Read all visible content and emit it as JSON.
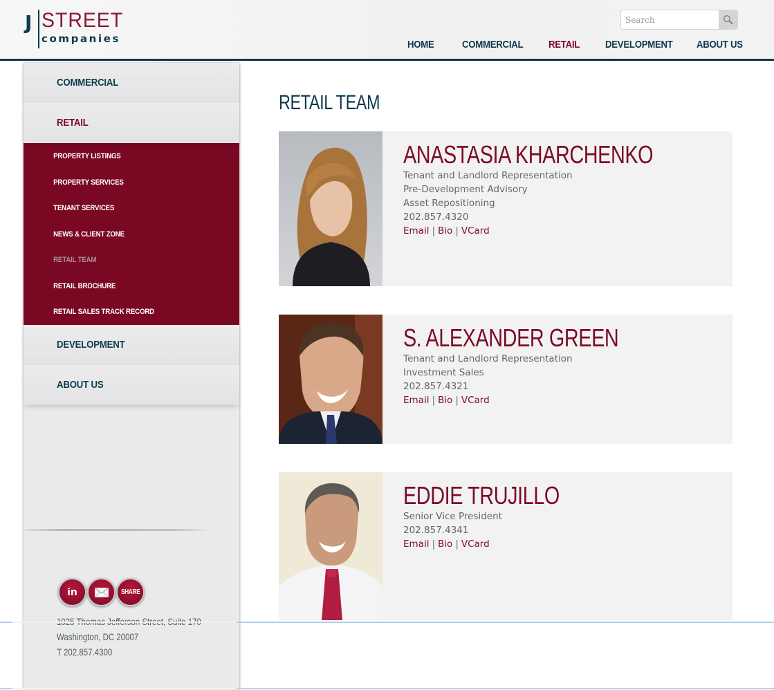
{
  "header": {
    "logo": {
      "j": "J",
      "street": "STREET",
      "companies": "companies"
    },
    "search": {
      "placeholder": "Search",
      "value": "",
      "icon": "search-icon"
    },
    "nav": [
      {
        "label": "HOME",
        "active": false
      },
      {
        "label": "COMMERCIAL",
        "active": false
      },
      {
        "label": "RETAIL",
        "active": true
      },
      {
        "label": "DEVELOPMENT",
        "active": false
      },
      {
        "label": "ABOUT US",
        "active": false
      }
    ]
  },
  "sidebar": {
    "items": [
      {
        "label": "COMMERCIAL",
        "active": false
      },
      {
        "label": "RETAIL",
        "active": true
      },
      {
        "label": "DEVELOPMENT",
        "active": false
      },
      {
        "label": "ABOUT US",
        "active": false
      }
    ],
    "retail_submenu": [
      {
        "label": "PROPERTY LISTINGS",
        "current": false
      },
      {
        "label": "PROPERTY SERVICES",
        "current": false
      },
      {
        "label": "TENANT SERVICES",
        "current": false
      },
      {
        "label": "NEWS & CLIENT ZONE",
        "current": false
      },
      {
        "label": "RETAIL TEAM",
        "current": true
      },
      {
        "label": "RETAIL BROCHURE",
        "current": false
      },
      {
        "label": "RETAIL SALES TRACK RECORD",
        "current": false
      }
    ],
    "social": [
      {
        "icon": "linkedin-icon",
        "label": "in"
      },
      {
        "icon": "email-icon",
        "label": ""
      },
      {
        "icon": "share-icon",
        "label": "SHARE"
      }
    ],
    "address": {
      "line1": "1025 Thomas Jefferson Street, Suite 170",
      "line2": "Washington, DC 20007",
      "phone": "T 202.857.4300"
    }
  },
  "main": {
    "title": "RETAIL TEAM",
    "team": [
      {
        "name": "ANASTASIA KHARCHENKO",
        "details": [
          "Tenant and Landlord Representation",
          "Pre-Development Advisory",
          "Asset Repositioning"
        ],
        "phone": "202.857.4320",
        "links": [
          "Email",
          "Bio",
          "VCard"
        ],
        "link_separator": "|"
      },
      {
        "name": "S. ALEXANDER GREEN",
        "details": [
          "Tenant and Landlord Representation",
          "Investment Sales"
        ],
        "phone": "202.857.4321",
        "links": [
          "Email",
          "Bio",
          "VCard"
        ],
        "link_separator": "|"
      },
      {
        "name": "EDDIE TRUJILLO",
        "details": [
          "Senior Vice President"
        ],
        "phone": "202.857.4341",
        "links": [
          "Email",
          "Bio",
          "VCard"
        ],
        "link_separator": "|"
      }
    ]
  },
  "colors": {
    "navy": "#0d3a4d",
    "maroon": "#7c0a26",
    "submenu_bg": "#7b0823",
    "card_bg": "#f2f2f2",
    "sidebar_bg": "#eaeaea"
  }
}
